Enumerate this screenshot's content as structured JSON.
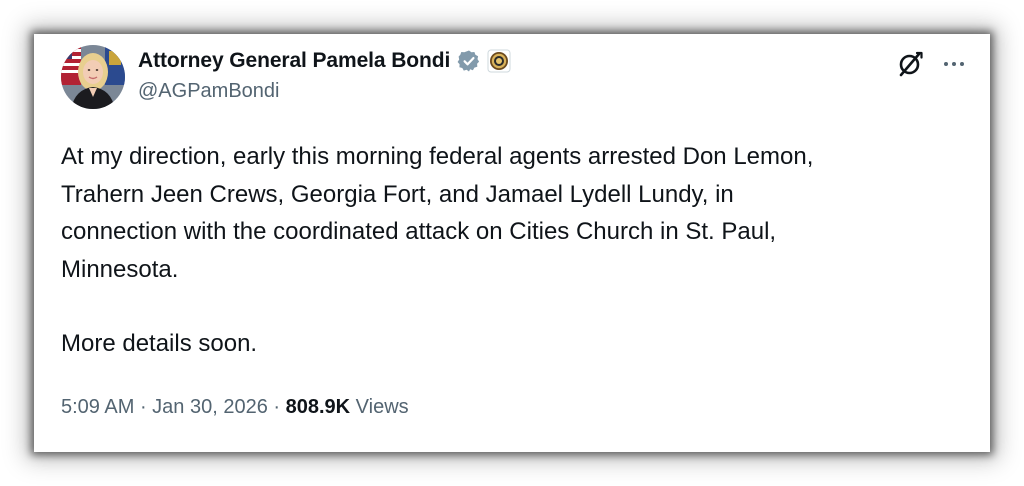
{
  "tweet": {
    "author": {
      "display_name": "Attorney General Pamela Bondi",
      "handle": "@AGPamBondi",
      "avatar_icon": "profile-photo",
      "verified_icon": "verified-badge-icon",
      "affiliation_icon": "department-of-justice-seal-icon"
    },
    "header_actions": {
      "grok_icon": "grok-icon",
      "more_icon": "more-options-icon"
    },
    "body": {
      "paragraph_1": "At my direction, early this morning federal agents arrested Don Lemon,\nTrahern Jeen Crews, Georgia Fort, and Jamael Lydell Lundy, in\nconnection with the coordinated attack on Cities Church in St. Paul,\nMinnesota.",
      "paragraph_2": "More details soon."
    },
    "meta": {
      "time": "5:09 AM",
      "separator": " · ",
      "date": "Jan 30, 2026",
      "views_count": "808.9K",
      "views_label": "Views"
    }
  },
  "colors": {
    "text_primary": "#0f1419",
    "text_secondary": "#536471",
    "verified_blue": "#1d9bf0",
    "verified_grey": "#829aab"
  }
}
